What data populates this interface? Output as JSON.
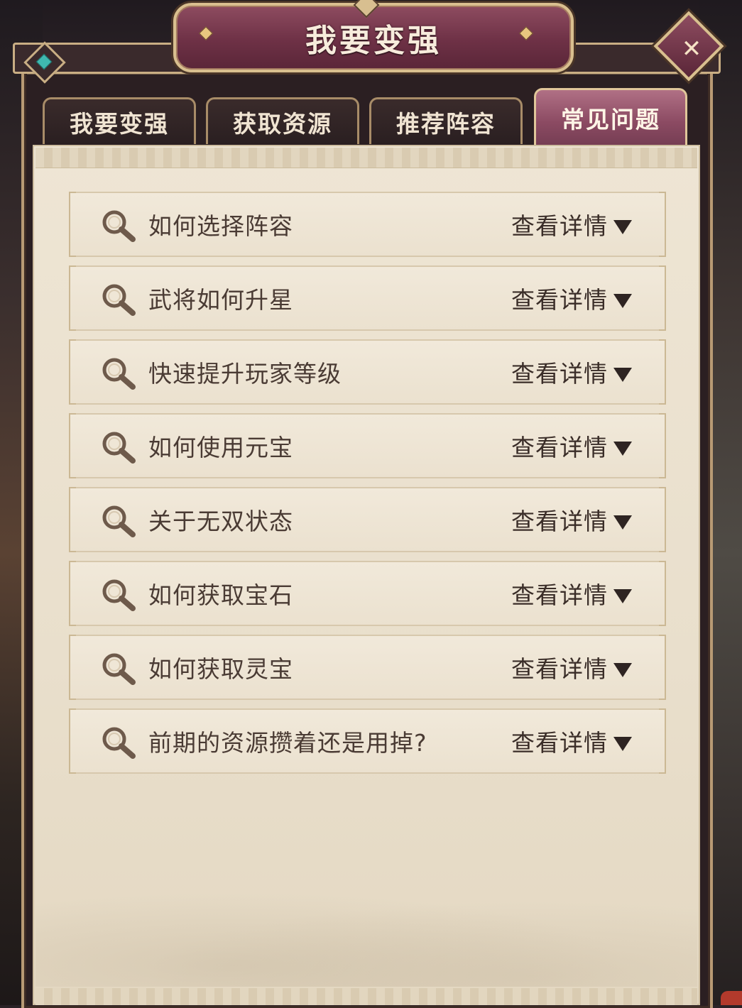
{
  "window": {
    "title": "我要变强",
    "close_icon": "close-icon"
  },
  "tabs": [
    {
      "label": "我要变强",
      "active": false
    },
    {
      "label": "获取资源",
      "active": false
    },
    {
      "label": "推荐阵容",
      "active": false
    },
    {
      "label": "常见问题",
      "active": true
    }
  ],
  "faq": {
    "icon": "magnifier-icon",
    "items": [
      {
        "question": "如何选择阵容",
        "detail": "查看详情"
      },
      {
        "question": "武将如何升星",
        "detail": "查看详情"
      },
      {
        "question": "快速提升玩家等级",
        "detail": "查看详情"
      },
      {
        "question": "如何使用元宝",
        "detail": "查看详情"
      },
      {
        "question": "关于无双状态",
        "detail": "查看详情"
      },
      {
        "question": "如何获取宝石",
        "detail": "查看详情"
      },
      {
        "question": "如何获取灵宝",
        "detail": "查看详情"
      },
      {
        "question": "前期的资源攒着还是用掉?",
        "detail": "查看详情"
      }
    ]
  },
  "colors": {
    "accent": "#8b4a62",
    "panel": "#eee5d4",
    "gold_border": "#d9bf8f",
    "text": "#4a3b34"
  }
}
